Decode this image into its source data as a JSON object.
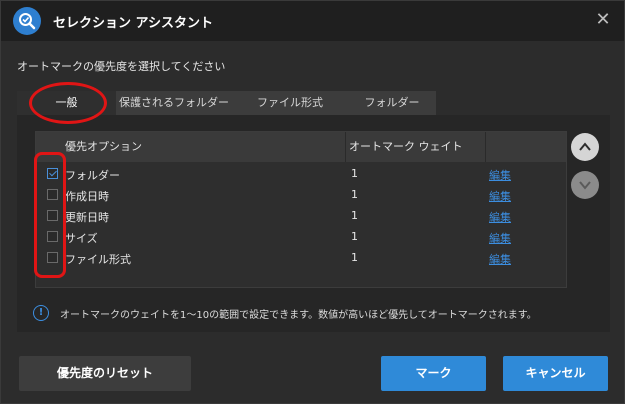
{
  "window": {
    "title": "セレクション アシスタント",
    "app_icon": "magnifier-check-icon",
    "close_icon": "close-icon"
  },
  "instruction": "オートマークの優先度を選択してください",
  "tabs": [
    {
      "label": "一般",
      "active": true
    },
    {
      "label": "保護されるフォルダー",
      "active": false
    },
    {
      "label": "ファイル形式",
      "active": false
    },
    {
      "label": "フォルダー",
      "active": false
    }
  ],
  "table": {
    "headers": [
      "優先オプション",
      "オートマーク ウェイト"
    ],
    "rows": [
      {
        "name": "フォルダー",
        "weight": "1",
        "edit": "編集",
        "checked": true
      },
      {
        "name": "作成日時",
        "weight": "1",
        "edit": "編集",
        "checked": false
      },
      {
        "name": "更新日時",
        "weight": "1",
        "edit": "編集",
        "checked": false
      },
      {
        "name": "サイズ",
        "weight": "1",
        "edit": "編集",
        "checked": false
      },
      {
        "name": "ファイル形式",
        "weight": "1",
        "edit": "編集",
        "checked": false
      }
    ]
  },
  "order_buttons": {
    "up": "chevron-up-icon",
    "down": "chevron-down-icon",
    "down_enabled": false
  },
  "info": {
    "icon": "info-icon",
    "text": "オートマークのウェイトを1～10の範囲で設定できます。数値が高いほど優先してオートマークされます。"
  },
  "buttons": {
    "reset": "優先度のリセット",
    "mark": "マーク",
    "cancel": "キャンセル"
  },
  "colors": {
    "accent": "#2f8ad8",
    "link": "#3c8ee0",
    "annotation": "#e01515",
    "background": "#2c2c2c",
    "titlebar": "#1f1f1f"
  }
}
